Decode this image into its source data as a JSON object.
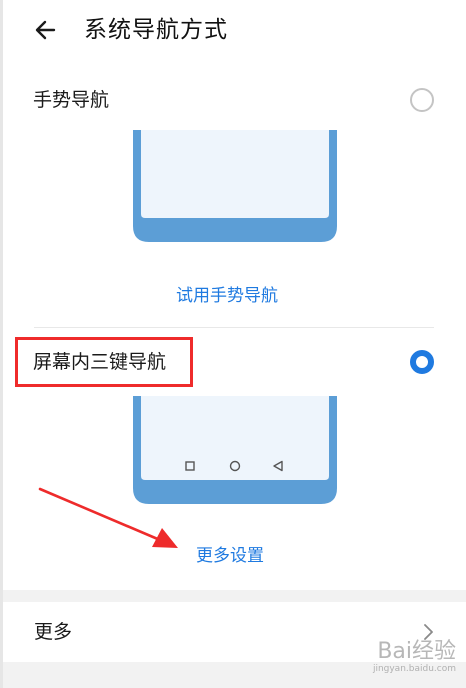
{
  "header": {
    "title": "系统导航方式",
    "back_icon": "arrow-left-icon"
  },
  "options": [
    {
      "label": "手势导航",
      "selected": false,
      "action_label": "试用手势导航"
    },
    {
      "label": "屏幕内三键导航",
      "selected": true,
      "action_label": "更多设置"
    }
  ],
  "more": {
    "label": "更多",
    "chevron_icon": "chevron-right-icon"
  },
  "watermark": {
    "logo": "Bai经验",
    "url": "jingyan.baidu.com"
  },
  "colors": {
    "accent": "#1f7ae0",
    "highlight": "#ef2b2b",
    "phone_frame": "#5c9ed6",
    "phone_screen": "#eef5fc"
  }
}
